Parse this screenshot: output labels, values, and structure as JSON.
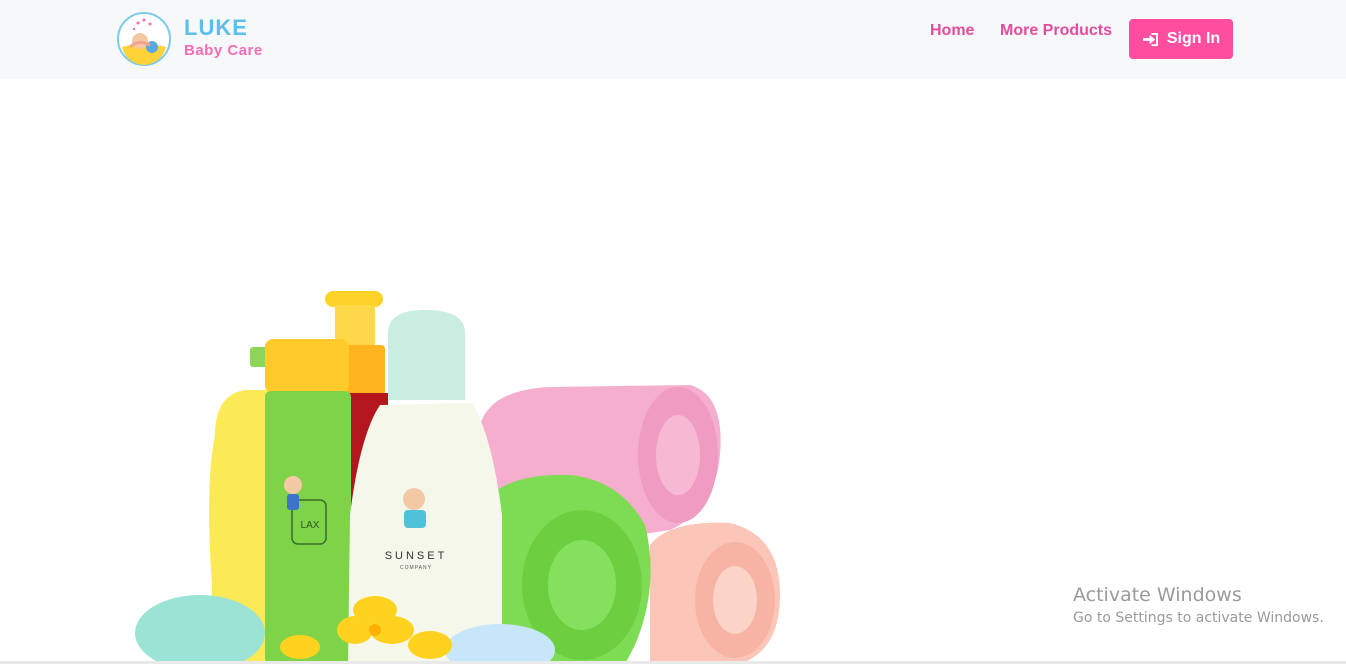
{
  "brand": {
    "name": "LUKE",
    "tagline": "Baby Care"
  },
  "nav": {
    "home": "Home",
    "more_products": "More Products",
    "sign_in": "Sign In"
  },
  "hero": {
    "bottle_label_1": "LAX",
    "bottle_label_2": "SUNSET",
    "bottle_label_2_sub": "COMPANY"
  },
  "watermark": {
    "title": "Activate Windows",
    "subtitle": "Go to Settings to activate Windows."
  },
  "colors": {
    "brand_blue": "#5bc0eb",
    "brand_pink": "#f46db5",
    "nav_link": "#e64a9b",
    "button": "#ff4d9f",
    "navbar_bg": "#f7f8fa"
  },
  "icons": {
    "logo": "baby-logo-icon",
    "sign_in": "sign-in-icon"
  }
}
